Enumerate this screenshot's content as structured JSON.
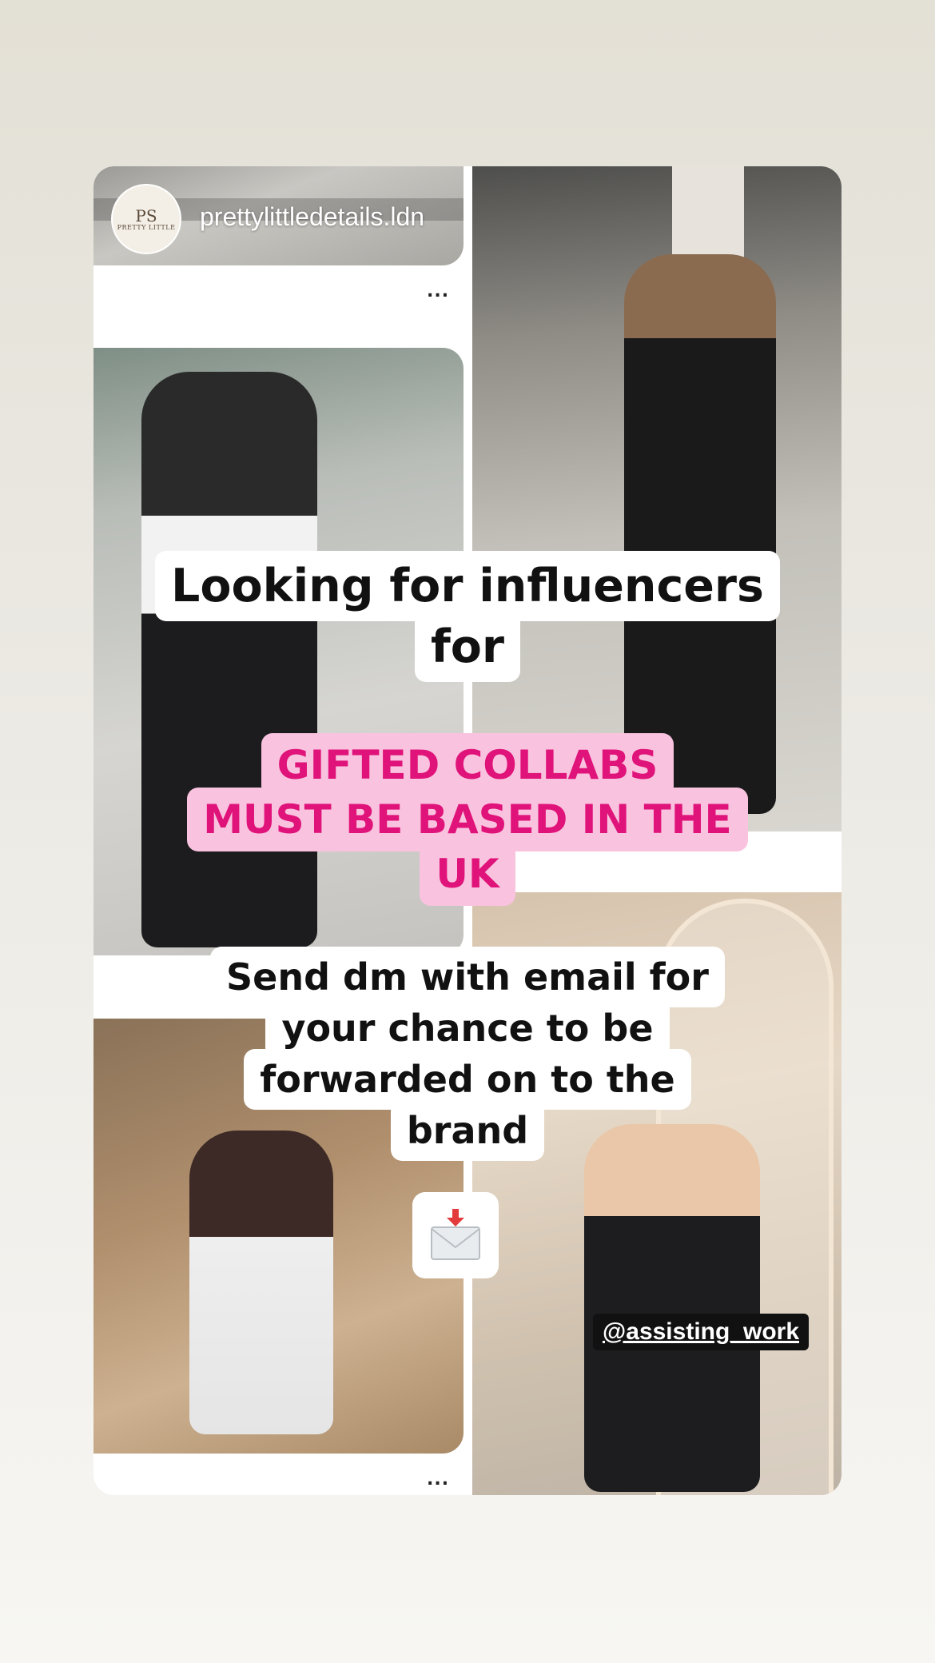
{
  "story": {
    "username": "prettylittledetails.ldn",
    "avatar": {
      "monogram": "PS",
      "brand": "PRETTY LITTLE"
    },
    "more_label_top": "...",
    "more_label_bottom": "...",
    "caption_lines_1": [
      "Looking for influencers",
      "for"
    ],
    "caption_lines_2": [
      "GIFTED COLLABS",
      "MUST BE BASED IN THE",
      "UK"
    ],
    "caption_lines_3": [
      "Send dm with email for",
      "your chance to be",
      "forwarded on to the",
      "brand"
    ],
    "sticker_icon": "incoming-envelope-icon",
    "mention": "@assisting_work"
  },
  "colors": {
    "caption_highlight_pink": "#f9c3df",
    "caption_text_pink": "#e0137a",
    "mention_bg": "#111111"
  }
}
